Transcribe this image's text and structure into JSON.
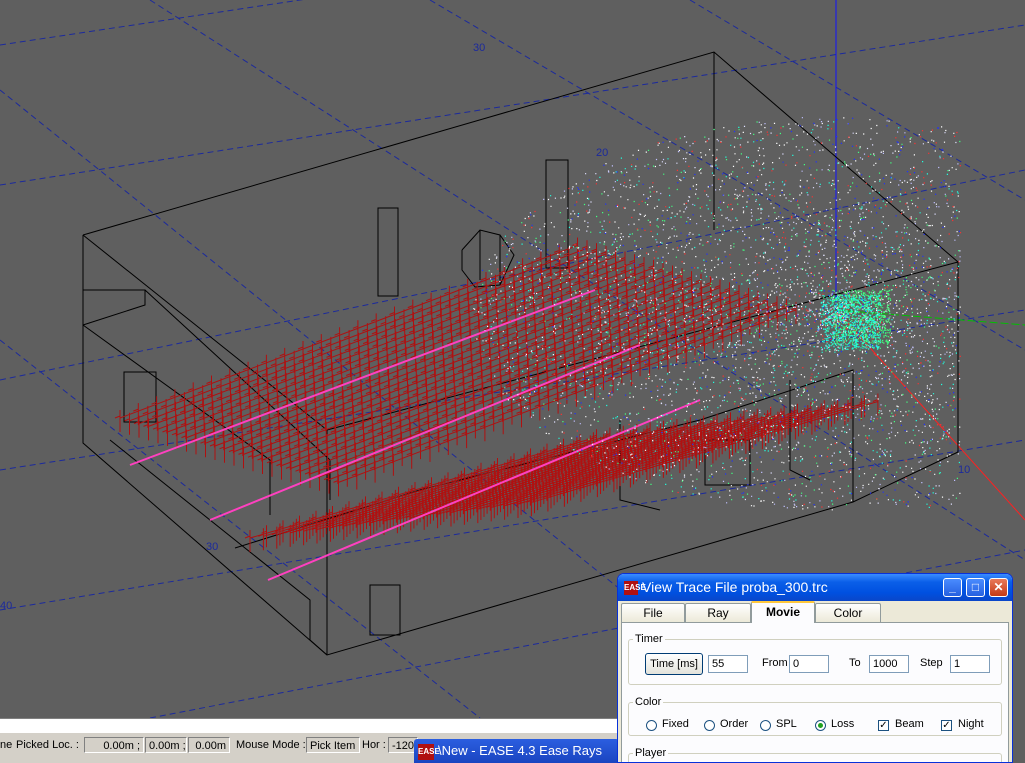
{
  "viewport": {
    "background": "#5f5f5f",
    "grid_labels": [
      "30",
      "20",
      "10",
      "30",
      "40"
    ],
    "axis_colors": {
      "x": "#ff2020",
      "y": "#00c000",
      "z": "#1010ff"
    },
    "seat_color": "#b01010",
    "aisle_color": "#ff40c0"
  },
  "status_bar": {
    "left_cut": "ne",
    "picked_label": "Picked Loc. :",
    "picked_x": "0.00m ;",
    "picked_y": "0.00m ;",
    "picked_z": "0.00m",
    "mouse_mode_label": "Mouse Mode :",
    "mouse_mode_value": "Pick Item",
    "hor_label": "Hor :",
    "hor_value": "-120"
  },
  "taskbar": {
    "icon": "ease-app-icon",
    "title": "\\New - EASE 4.3 Ease Rays"
  },
  "window": {
    "title": "View Trace File proba_300.trc",
    "icon": "ease-app-icon",
    "tabs": [
      {
        "label": "File",
        "active": false
      },
      {
        "label": "Ray",
        "active": false
      },
      {
        "label": "Movie",
        "active": true
      },
      {
        "label": "Color",
        "active": false
      }
    ],
    "timer": {
      "legend": "Timer",
      "time_button": "Time [ms]",
      "time_value": "55",
      "from_label": "From",
      "from_value": "0",
      "to_label": "To",
      "to_value": "1000",
      "step_label": "Step",
      "step_value": "1"
    },
    "color": {
      "legend": "Color",
      "options": [
        {
          "label": "Fixed",
          "selected": false
        },
        {
          "label": "Order",
          "selected": false
        },
        {
          "label": "SPL",
          "selected": false
        },
        {
          "label": "Loss",
          "selected": true
        }
      ],
      "beam_label": "Beam",
      "beam_checked": true,
      "night_label": "Night",
      "night_checked": true
    },
    "player": {
      "legend": "Player"
    }
  }
}
